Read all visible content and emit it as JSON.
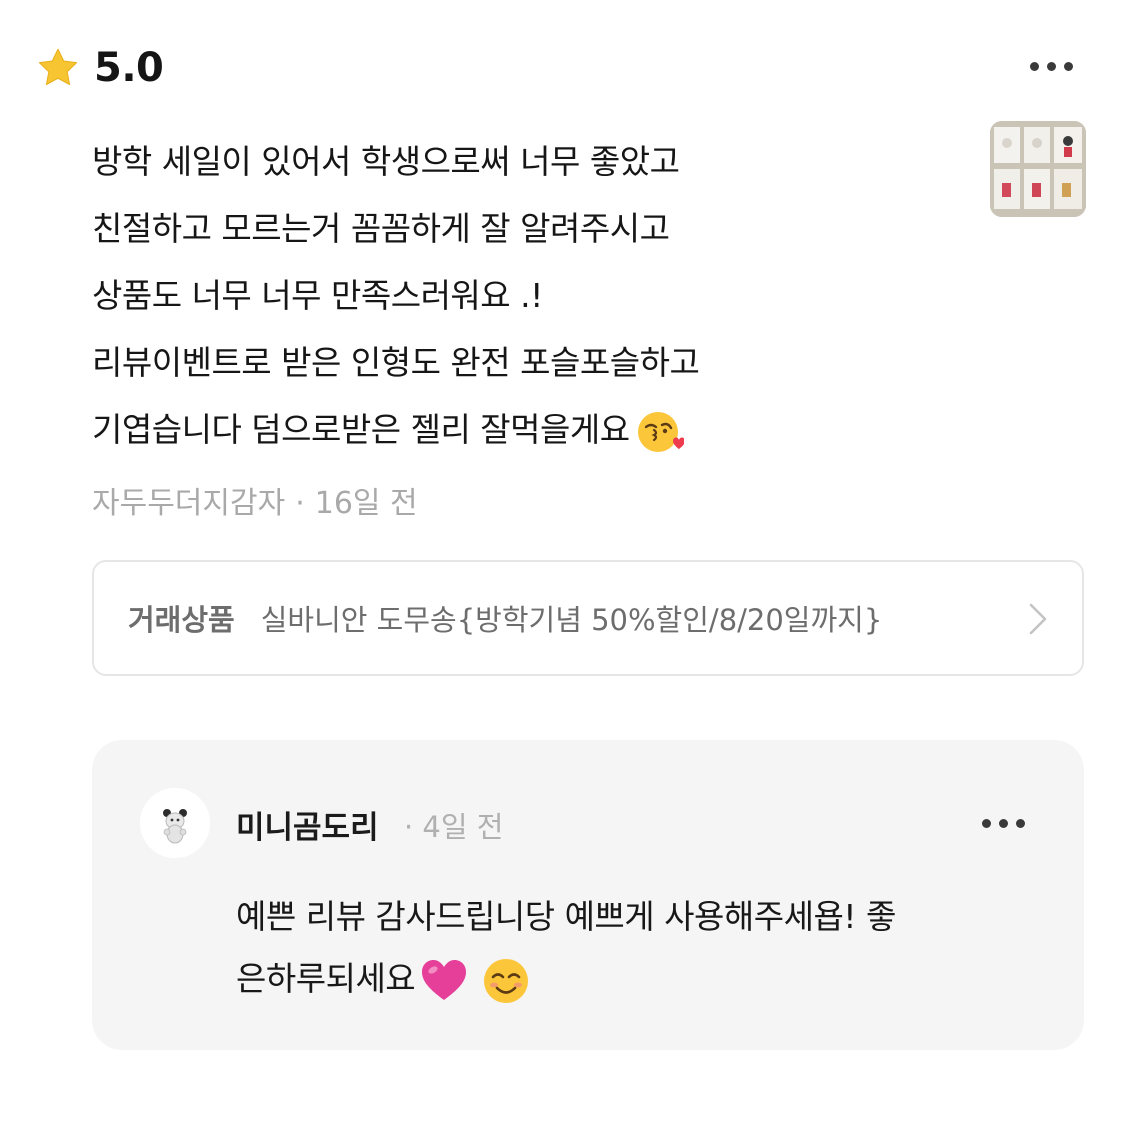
{
  "review": {
    "rating": "5.0",
    "lines": [
      "방학 세일이 있어서 학생으로써  너무 좋았고",
      "친절하고 모르는거 꼼꼼하게 잘 알려주시고",
      "상품도 너무 너무 만족스러워요 .!",
      "리뷰이벤트로 받은 인형도 완전 포슬포슬하고",
      "기엽습니다 덤으로받은 젤리 잘먹을게요"
    ],
    "author": "자두두더지감자",
    "separator": "·",
    "time": "16일 전"
  },
  "product": {
    "label": "거래상품",
    "name": "실바니안 도무송{방학기념 50%할인/8/20일까지}"
  },
  "reply": {
    "name": "미니곰도리",
    "meta": "· 4일 전",
    "lines": [
      "예쁜 리뷰 감사드립니당 예쁘게 사용해주세욥! 좋",
      "은하루되세요"
    ]
  },
  "colors": {
    "star": "#f7c531",
    "muted_text": "#a9a9a9",
    "reply_bg": "#f5f5f5",
    "heart": "#e53f9a"
  },
  "icons": {
    "rating": "star-icon",
    "more": "more-horizontal-icon",
    "chevron": "chevron-right-icon",
    "emoji_kiss": "face-blowing-kiss-emoji",
    "emoji_heart": "pink-heart-emoji",
    "emoji_smile": "smiling-face-emoji"
  }
}
